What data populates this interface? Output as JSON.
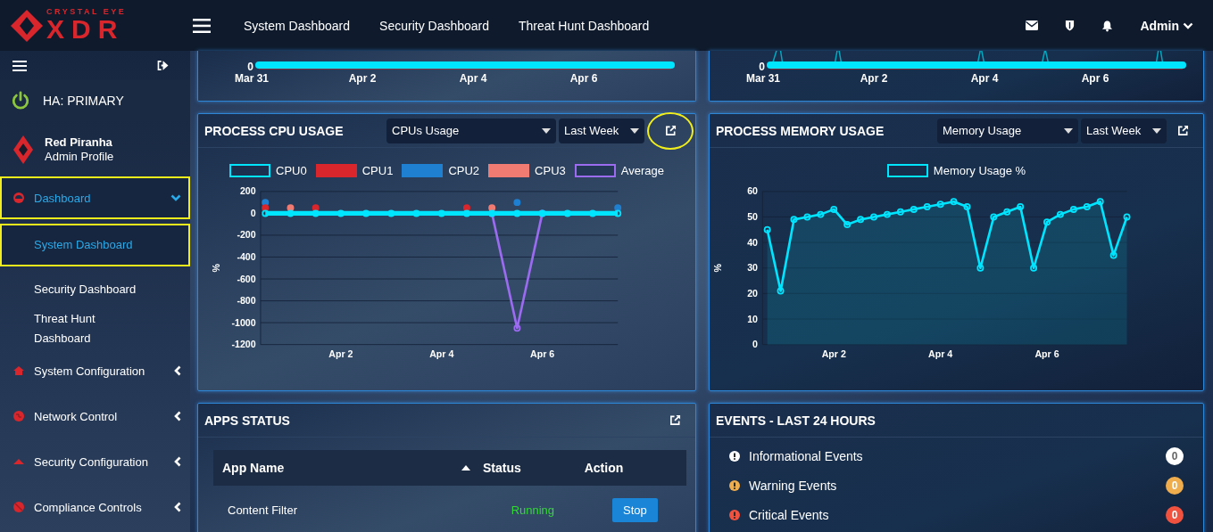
{
  "header": {
    "logo": {
      "tagline": "CRYSTAL EYE",
      "name": "XDR"
    },
    "nav": [
      {
        "label": "System Dashboard"
      },
      {
        "label": "Security Dashboard"
      },
      {
        "label": "Threat Hunt Dashboard"
      }
    ],
    "user": "Admin"
  },
  "sidebar": {
    "ha_status": "HA: PRIMARY",
    "profile": {
      "name": "Red Piranha",
      "role": "Admin Profile"
    },
    "menu": [
      {
        "label": "Dashboard",
        "selected": true,
        "expanded": true,
        "highlighted": true,
        "children": [
          {
            "label": "System Dashboard",
            "selected": true,
            "highlighted": true
          },
          {
            "label": "Security Dashboard",
            "selected": false,
            "highlighted": false
          },
          {
            "label": "Threat Hunt Dashboard",
            "selected": false,
            "highlighted": false
          }
        ]
      },
      {
        "label": "System Configuration",
        "selected": false,
        "expanded": false,
        "highlighted": false
      },
      {
        "label": "Network Control",
        "selected": false,
        "expanded": false,
        "highlighted": false
      },
      {
        "label": "Security Configuration",
        "selected": false,
        "expanded": false,
        "highlighted": false
      },
      {
        "label": "Compliance Controls",
        "selected": false,
        "expanded": false,
        "highlighted": false
      }
    ]
  },
  "partial_charts": [
    {
      "y_tick": "0",
      "x_labels": [
        "Mar 31",
        "Apr 2",
        "Apr 4",
        "Apr 6"
      ]
    },
    {
      "y_tick": "0",
      "x_labels": [
        "Mar 31",
        "Apr 2",
        "Apr 4",
        "Apr 6"
      ]
    }
  ],
  "cpu_panel": {
    "title": "PROCESS CPU USAGE",
    "metric_select": "CPUs Usage",
    "range_select": "Last Week",
    "open_icon_highlighted": true,
    "chart_data": {
      "type": "line",
      "ylabel": "%",
      "categories": [
        null,
        null,
        null,
        "Apr 2",
        null,
        null,
        null,
        "Apr 4",
        null,
        null,
        null,
        "Apr 6",
        null,
        null,
        null
      ],
      "ylim": [
        -1200,
        200
      ],
      "yticks": [
        200,
        0,
        -200,
        -400,
        -600,
        -800,
        -1000,
        -1200
      ],
      "grid": true,
      "legend": "top",
      "series": [
        {
          "name": "CPU0",
          "color": "#00e5ff",
          "marker": true,
          "values": [
            0,
            0,
            0,
            0,
            0,
            0,
            0,
            0,
            0,
            0,
            0,
            0,
            0,
            0,
            0
          ]
        },
        {
          "name": "CPU1",
          "color": "#d9262c",
          "type": "scatter",
          "marker": true,
          "values": [
            50,
            null,
            50,
            null,
            null,
            null,
            null,
            null,
            50,
            null,
            null,
            null,
            null,
            null,
            null
          ]
        },
        {
          "name": "CPU2",
          "color": "#1f7fd0",
          "type": "scatter",
          "marker": true,
          "values": [
            100,
            null,
            null,
            null,
            null,
            null,
            null,
            null,
            null,
            null,
            100,
            null,
            null,
            null,
            50
          ]
        },
        {
          "name": "CPU3",
          "color": "#f07b72",
          "type": "scatter",
          "marker": true,
          "values": [
            null,
            50,
            null,
            null,
            null,
            null,
            null,
            null,
            null,
            50,
            null,
            null,
            null,
            null,
            null
          ]
        },
        {
          "name": "Average",
          "color": "#9b6bf0",
          "marker": true,
          "values": [
            null,
            null,
            null,
            null,
            null,
            null,
            null,
            null,
            null,
            0,
            -1050,
            0,
            null,
            null,
            null
          ]
        }
      ]
    }
  },
  "memory_panel": {
    "title": "PROCESS MEMORY USAGE",
    "metric_select": "Memory Usage",
    "range_select": "Last Week",
    "open_icon_highlighted": false,
    "chart_data": {
      "type": "area",
      "ylabel": "%",
      "categories": [
        null,
        null,
        null,
        null,
        null,
        "Apr 2",
        null,
        null,
        null,
        null,
        null,
        null,
        null,
        "Apr 4",
        null,
        null,
        null,
        null,
        null,
        null,
        null,
        "Apr 6",
        null,
        null,
        null,
        null,
        null,
        null
      ],
      "ylim": [
        0,
        60
      ],
      "yticks": [
        60,
        50,
        40,
        30,
        20,
        10,
        0
      ],
      "grid": true,
      "legend": "top",
      "series": [
        {
          "name": "Memory Usage %",
          "color": "#00e5ff",
          "marker": true,
          "values": [
            45,
            21,
            49,
            50,
            51,
            53,
            47,
            49,
            50,
            51,
            52,
            53,
            54,
            55,
            56,
            54,
            30,
            50,
            52,
            54,
            30,
            48,
            51,
            53,
            54,
            56,
            35,
            50
          ]
        }
      ]
    }
  },
  "apps_panel": {
    "title": "APPS STATUS",
    "columns": [
      {
        "label": "App Name",
        "sorted": true
      },
      {
        "label": "Status",
        "sorted": false
      },
      {
        "label": "Action",
        "sorted": false
      }
    ],
    "rows": [
      {
        "name": "Content Filter",
        "status": "Running",
        "action": "Stop"
      }
    ]
  },
  "events_panel": {
    "title": "EVENTS - LAST 24 HOURS",
    "items": [
      {
        "label": "Informational Events",
        "count": "0",
        "color": "#ffffff"
      },
      {
        "label": "Warning Events",
        "count": "0",
        "color": "#f0ad4e"
      },
      {
        "label": "Critical Events",
        "count": "0",
        "color": "#f0523f"
      }
    ]
  }
}
